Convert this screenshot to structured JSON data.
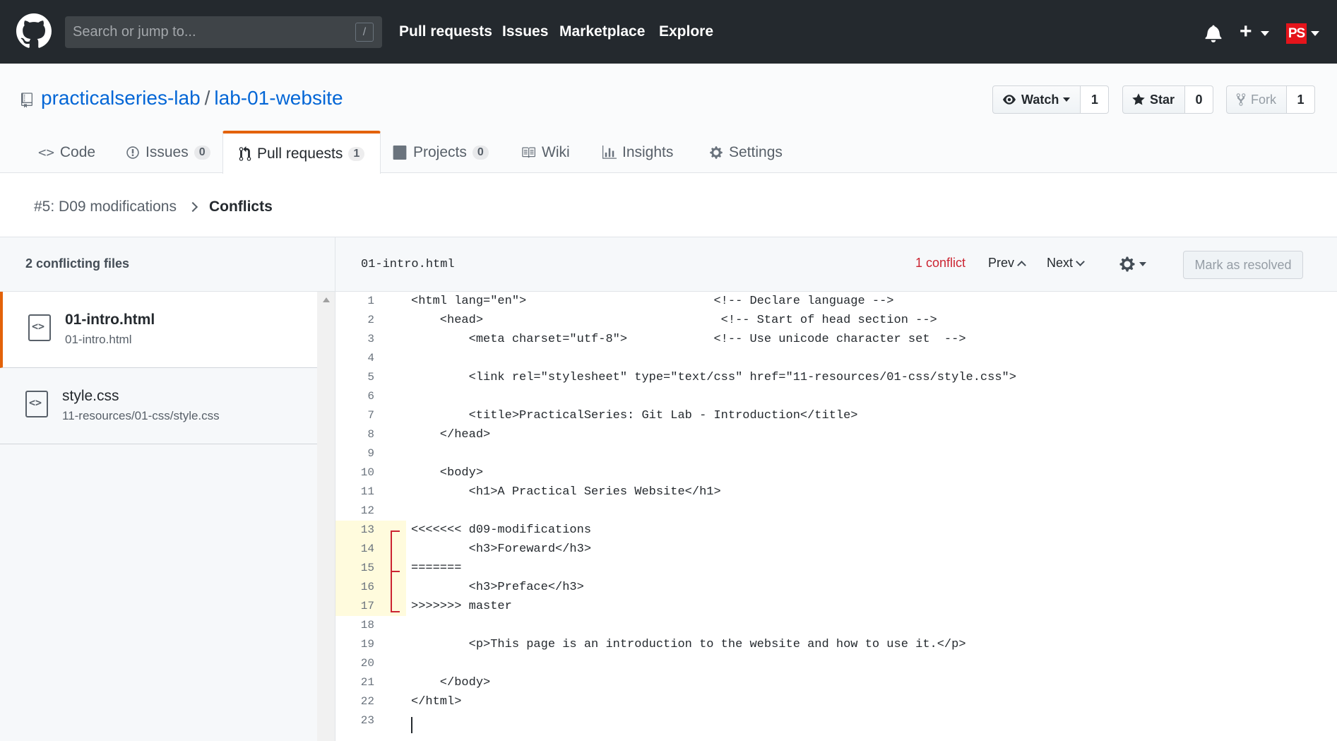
{
  "header": {
    "search_placeholder": "Search or jump to...",
    "search_shortcut": "/",
    "nav": [
      "Pull requests",
      "Issues",
      "Marketplace",
      "Explore"
    ],
    "avatar_initials": "PS"
  },
  "repo": {
    "owner": "practicalseries-lab",
    "separator": "/",
    "name": "lab-01-website",
    "watch_label": "Watch",
    "watch_count": "1",
    "star_label": "Star",
    "star_count": "0",
    "fork_label": "Fork",
    "fork_count": "1"
  },
  "tabs": [
    {
      "label": "Code",
      "icon": "code-icon"
    },
    {
      "label": "Issues",
      "count": "0",
      "icon": "issue-icon"
    },
    {
      "label": "Pull requests",
      "count": "1",
      "icon": "pull-request-icon",
      "selected": true
    },
    {
      "label": "Projects",
      "count": "0",
      "icon": "project-icon"
    },
    {
      "label": "Wiki",
      "icon": "book-icon"
    },
    {
      "label": "Insights",
      "icon": "graph-icon"
    },
    {
      "label": "Settings",
      "icon": "gear-icon"
    }
  ],
  "breadcrumb": {
    "parent": "#5: D09 modifications",
    "current": "Conflicts"
  },
  "sidebar": {
    "heading": "2 conflicting files",
    "files": [
      {
        "name": "01-intro.html",
        "path": "01-intro.html",
        "active": true
      },
      {
        "name": "style.css",
        "path": "11-resources/01-css/style.css",
        "active": false
      }
    ]
  },
  "editor": {
    "filename": "01-intro.html",
    "conflict_count": "1 conflict",
    "prev_label": "Prev",
    "next_label": "Next",
    "resolve_label": "Mark as resolved",
    "conflict_lines": [
      13,
      14,
      15,
      16,
      17
    ],
    "lines": [
      "<html lang=\"en\">                          <!-- Declare language -->",
      "    <head>                                 <!-- Start of head section -->",
      "        <meta charset=\"utf-8\">            <!-- Use unicode character set  -->",
      "",
      "        <link rel=\"stylesheet\" type=\"text/css\" href=\"11-resources/01-css/style.css\">",
      "",
      "        <title>PracticalSeries: Git Lab - Introduction</title>",
      "    </head>",
      "",
      "    <body>",
      "        <h1>A Practical Series Website</h1>",
      "",
      "<<<<<<< d09-modifications",
      "        <h3>Foreward</h3>",
      "=======",
      "        <h3>Preface</h3>",
      ">>>>>>> master",
      "",
      "        <p>This page is an introduction to the website and how to use it.</p>",
      "",
      "    </body>",
      "</html>",
      ""
    ]
  },
  "colors": {
    "header_bg": "#24292e",
    "link": "#0366d6",
    "accent_tab": "#e36209",
    "conflict": "#cb2431"
  }
}
